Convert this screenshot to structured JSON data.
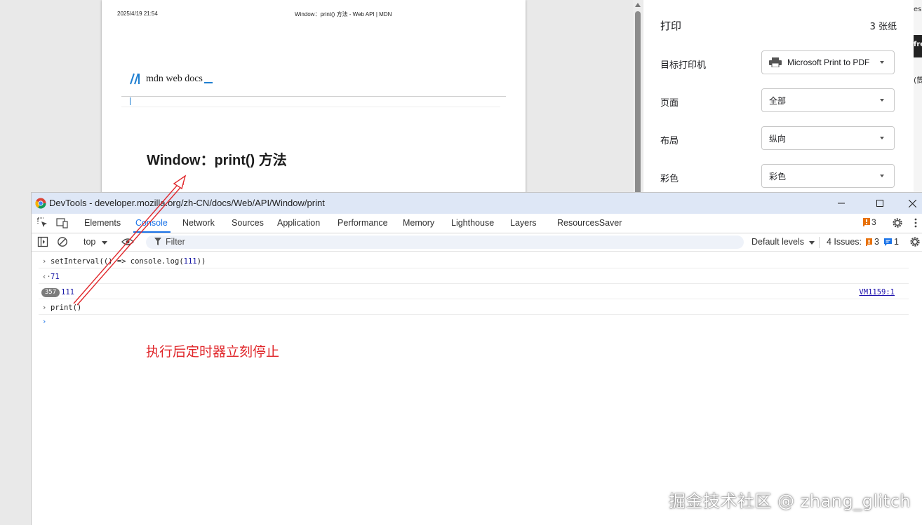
{
  "preview": {
    "date": "2025/4/19 21:54",
    "doc_title": "Window：print() 方法 - Web API | MDN",
    "logo_text": "mdn web docs",
    "heading": "Window：print() 方法"
  },
  "print_panel": {
    "title": "打印",
    "sheets": "3 张纸",
    "rows": [
      {
        "label": "目标打印机",
        "value": "Microsoft Print to PDF"
      },
      {
        "label": "页面",
        "value": "全部"
      },
      {
        "label": "布局",
        "value": "纵向"
      },
      {
        "label": "彩色",
        "value": "彩色"
      }
    ]
  },
  "right_strip": {
    "text_a": "es",
    "text_b": "fre",
    "text_c": "(筒"
  },
  "devtools": {
    "window_title": "DevTools - developer.mozilla.org/zh-CN/docs/Web/API/Window/print",
    "tabs": [
      "Elements",
      "Console",
      "Network",
      "Sources",
      "Application",
      "Performance",
      "Memory",
      "Lighthouse",
      "Layers",
      "ResourcesSaver"
    ],
    "active_tab": "Console",
    "issues_badge_count": "3",
    "toolbar": {
      "context": "top",
      "filter_placeholder": "Filter",
      "levels": "Default levels",
      "issues_label": "4 Issues:",
      "issues_warn": "3",
      "issues_info": "1"
    },
    "console": {
      "line1_code_a": "setInterval(() => console.log(",
      "line1_num": "111",
      "line1_code_b": "))",
      "line2_result": "71",
      "line3_badge": "357",
      "line3_value": "111",
      "line3_link": "VM1159:1",
      "line4_code": "print()",
      "annotation": "执行后定时器立刻停止"
    }
  },
  "watermark": "掘金技术社区 @ zhang_glitch",
  "colors": {
    "accent": "#1a73e8",
    "annotation": "#e0262a",
    "mdn_blue": "#1f7fd1"
  }
}
